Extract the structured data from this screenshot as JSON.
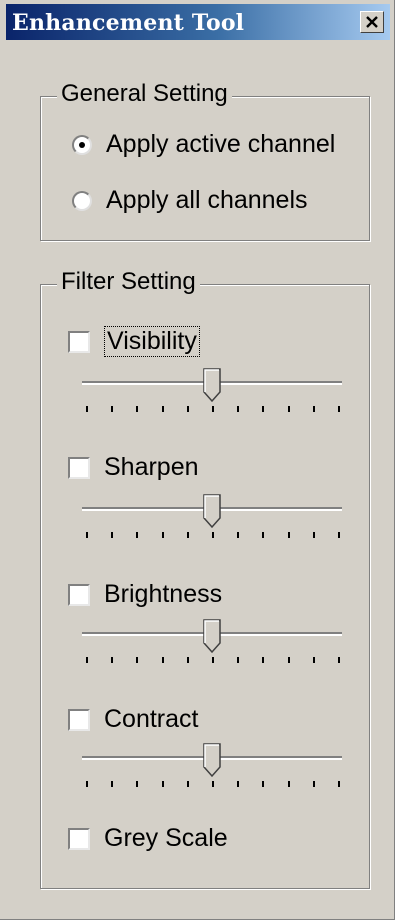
{
  "window": {
    "title": "Enhancement Tool"
  },
  "general_setting": {
    "legend": "General Setting",
    "options": [
      {
        "label": "Apply active channel",
        "selected": true
      },
      {
        "label": "Apply all channels",
        "selected": false
      }
    ]
  },
  "filter_setting": {
    "legend": "Filter Setting",
    "filters": [
      {
        "label": "Visibility",
        "checked": false,
        "slider_position": 0.5
      },
      {
        "label": "Sharpen",
        "checked": false,
        "slider_position": 0.5
      },
      {
        "label": "Brightness",
        "checked": false,
        "slider_position": 0.5
      },
      {
        "label": "Contract",
        "checked": false,
        "slider_position": 0.5
      }
    ],
    "grey_scale": {
      "label": "Grey Scale",
      "checked": false
    }
  },
  "colors": {
    "face": "#d4d0c8",
    "title_start": "#0a246a",
    "title_end": "#a6caf0"
  },
  "icons": {
    "close": "close-icon",
    "thumb": "slider-thumb"
  }
}
